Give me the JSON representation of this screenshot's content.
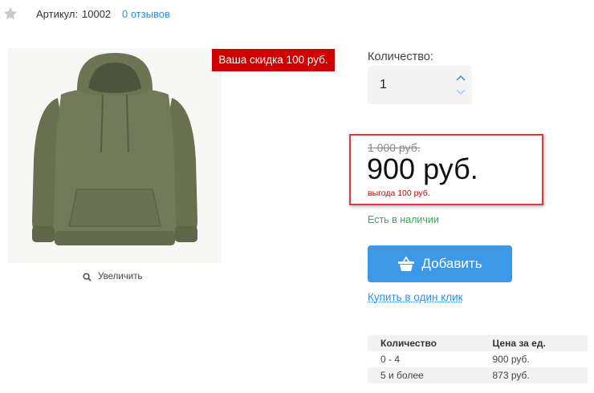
{
  "product_meta": {
    "sku_label": "Артикул:",
    "sku_value": "10002",
    "reviews_link": "0 отзывов",
    "favorite_icon": "star-icon"
  },
  "image": {
    "alt": "hoodie",
    "discount_badge": "Ваша скидка 100 руб.",
    "zoom_label": "Увеличить"
  },
  "quantity": {
    "label": "Количество:",
    "value": "1"
  },
  "price": {
    "old": "1 000 руб.",
    "current": "900 руб.",
    "savings": "выгода 100 руб.",
    "stock": "Есть в наличии"
  },
  "actions": {
    "add_label": "Добавить",
    "one_click_label": "Купить в один клик"
  },
  "price_table": {
    "headers": [
      "Количество",
      "Цена за ед."
    ],
    "rows": [
      [
        "0 - 4",
        "900 руб."
      ],
      [
        "5 и более",
        "873 руб."
      ]
    ]
  },
  "colors": {
    "accent_blue": "#3b99e8",
    "badge_red": "#d10000",
    "stock_green": "#3aa85a",
    "highlight_frame": "#e5353d",
    "hoodie": "#6f7556"
  }
}
